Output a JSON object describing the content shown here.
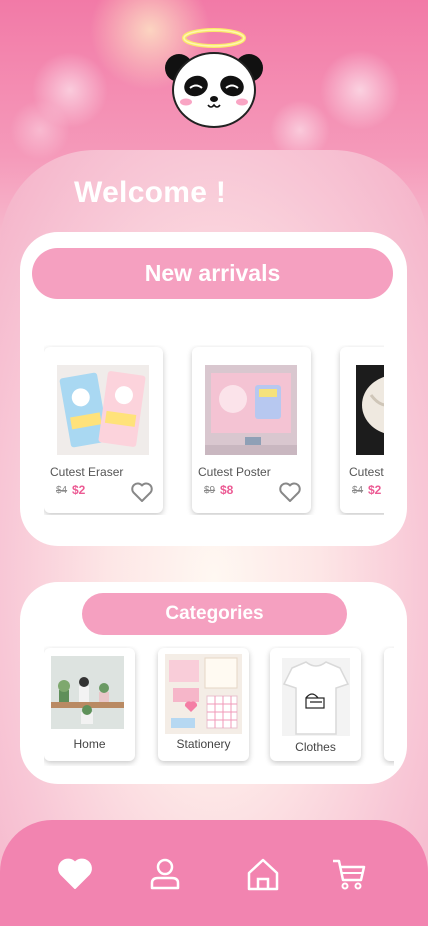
{
  "welcome": "Welcome !",
  "arrivals": {
    "title": "New arrivals",
    "products": [
      {
        "name": "Cutest Eraser",
        "old_price": "$4",
        "price": "$2"
      },
      {
        "name": "Cutest Poster",
        "old_price": "$9",
        "price": "$8"
      },
      {
        "name": "Cutest",
        "old_price": "$4",
        "price": "$2"
      }
    ]
  },
  "categories": {
    "title": "Categories",
    "items": [
      {
        "label": "Home"
      },
      {
        "label": "Stationery"
      },
      {
        "label": "Clothes"
      }
    ]
  },
  "nav": {
    "items": [
      "heart-icon",
      "user-icon",
      "home-icon",
      "cart-icon"
    ]
  },
  "colors": {
    "accent": "#f5a0c0",
    "price": "#ec5b94",
    "nav": "#f284b0"
  }
}
